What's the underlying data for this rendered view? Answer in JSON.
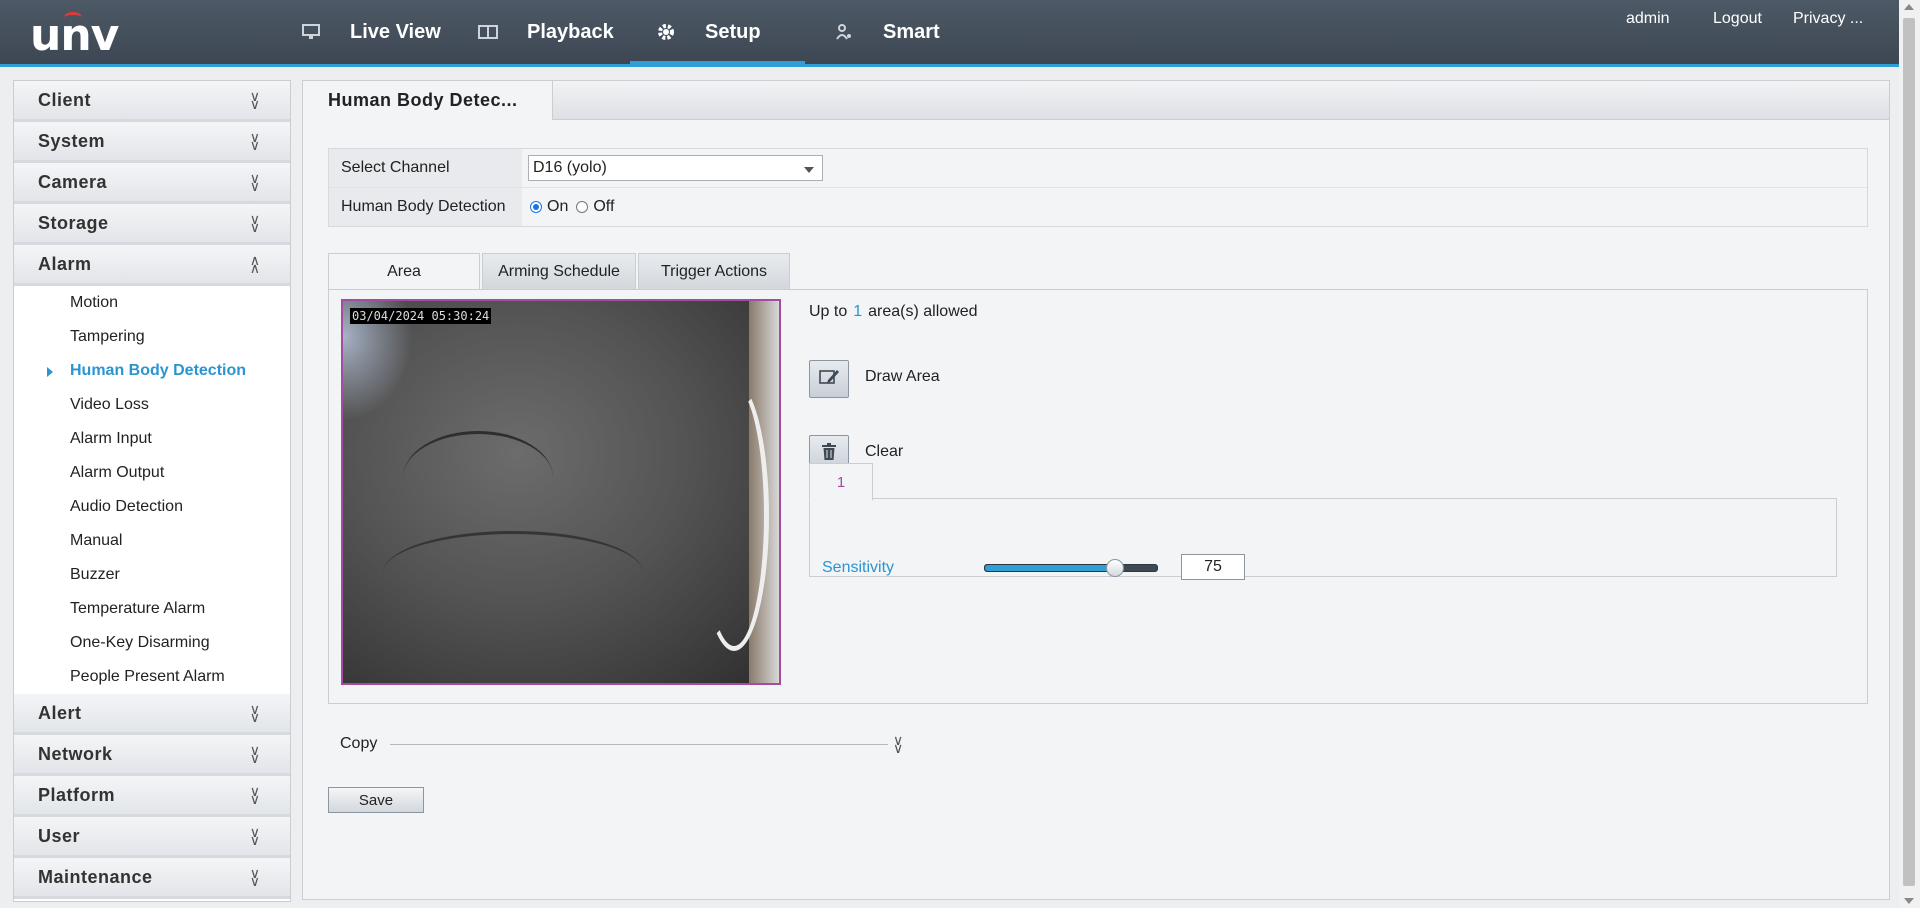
{
  "app": {
    "logo": "unv",
    "nav": [
      {
        "label": "Live View",
        "icon": "monitor-icon"
      },
      {
        "label": "Playback",
        "icon": "playback-icon"
      },
      {
        "label": "Setup",
        "icon": "gear-icon",
        "active": true
      },
      {
        "label": "Smart",
        "icon": "smart-person-icon"
      }
    ],
    "user": "admin",
    "logout": "Logout",
    "privacy": "Privacy ..."
  },
  "sidebar": {
    "sections": [
      {
        "label": "Client"
      },
      {
        "label": "System"
      },
      {
        "label": "Camera"
      },
      {
        "label": "Storage"
      },
      {
        "label": "Alarm",
        "expanded": true
      }
    ],
    "alarm_items": [
      "Motion",
      "Tampering",
      "Human Body Detection",
      "Video Loss",
      "Alarm Input",
      "Alarm Output",
      "Audio Detection",
      "Manual",
      "Buzzer",
      "Temperature Alarm",
      "One-Key Disarming",
      "People Present Alarm"
    ],
    "active_item": "Human Body Detection",
    "sections_after": [
      {
        "label": "Alert"
      },
      {
        "label": "Network"
      },
      {
        "label": "Platform"
      },
      {
        "label": "User"
      },
      {
        "label": "Maintenance"
      }
    ]
  },
  "page": {
    "title": "Human Body Detec...",
    "select_channel_label": "Select Channel",
    "select_channel_value": "D16 (yolo)",
    "detection_label": "Human Body Detection",
    "on_label": "On",
    "off_label": "Off",
    "detection_state": "On",
    "tabs": [
      "Area",
      "Arming Schedule",
      "Trigger Actions"
    ],
    "active_tab": "Area",
    "video_timestamp": "03/04/2024 05:30:24",
    "allowed_prefix": "Up to",
    "allowed_count": "1",
    "allowed_suffix": "area(s) allowed",
    "draw_area_label": "Draw Area",
    "clear_label": "Clear",
    "area_tab": "1",
    "sensitivity_label": "Sensitivity",
    "sensitivity_value": "75",
    "sensitivity_fraction": 0.75,
    "copy_label": "Copy",
    "save_label": "Save"
  },
  "colors": {
    "accent": "#2a95d1",
    "topbar": "#444f5b",
    "area_border": "#a34ca3"
  }
}
